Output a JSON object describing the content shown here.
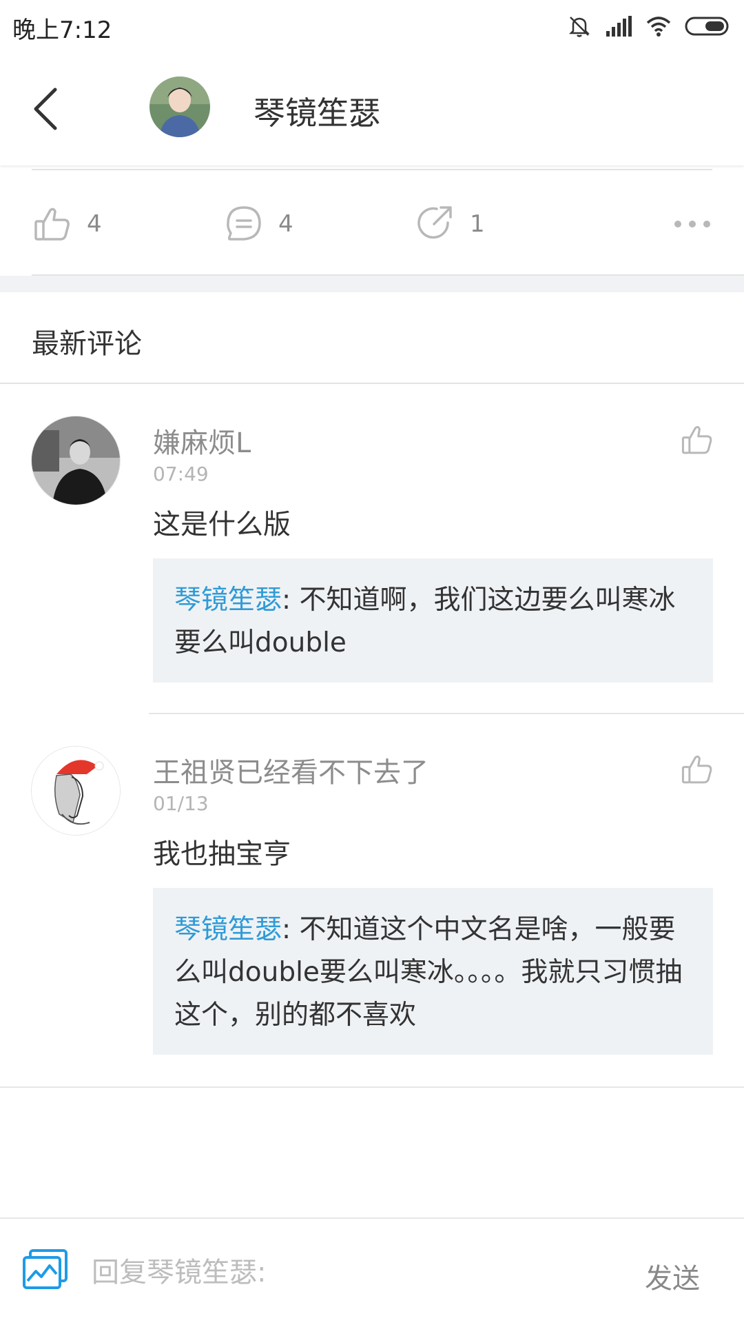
{
  "status_bar": {
    "time": "晚上7:12"
  },
  "header": {
    "title": "琴镜笙瑟"
  },
  "actions": {
    "like_count": "4",
    "comment_count": "4",
    "share_count": "1"
  },
  "section": {
    "title": "最新评论"
  },
  "comments": [
    {
      "name": "嫌麻烦L",
      "time": "07:49",
      "text": "这是什么版",
      "reply": {
        "author": "琴镜笙瑟",
        "text": ": 不知道啊，我们这边要么叫寒冰要么叫double"
      }
    },
    {
      "name": "王祖贤已经看不下去了",
      "time": "01/13",
      "text": "我也抽宝亨",
      "reply": {
        "author": "琴镜笙瑟",
        "text": ": 不知道这个中文名是啥，一般要么叫double要么叫寒冰。。。。我就只习惯抽这个，别的都不喜欢"
      }
    }
  ],
  "input": {
    "placeholder": "回复琴镜笙瑟:",
    "send_label": "发送"
  },
  "colors": {
    "accent_blue": "#2f9bd7",
    "reply_bg": "#eff2f5"
  }
}
